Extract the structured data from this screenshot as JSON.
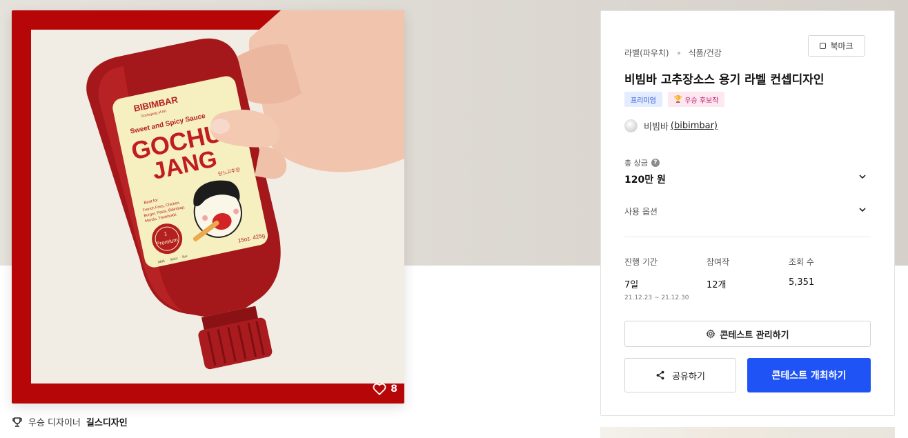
{
  "artwork": {
    "brand_text": "BIBIMBAR",
    "brand_sub": "Gochujang of Art",
    "label_line": "Sweet and Spicy Sauce",
    "product_word_1": "GOCHU",
    "product_word_2": "JANG",
    "korean_small": "단느고추장",
    "best_for": "Best for",
    "uses": [
      "French Fries, Chicken,",
      "Burger, Pasta, Bibimbap,",
      "Mandu, Tteokbokki"
    ],
    "premium_text": "Premium",
    "premium_no": "1",
    "net_weight": "15oz. 425g",
    "spice_scale": [
      "Mild",
      "Spicy",
      "Hot"
    ],
    "like_count": "8"
  },
  "winner": {
    "prefix": "우승 디자이너",
    "name": "길스디자인"
  },
  "panel": {
    "category_main": "라벨(파우치)",
    "category_sub": "식품/건강",
    "bookmark_label": "북마크",
    "title": "비빔바 고추장소스 용기 라벨 컨셉디자인",
    "badges": {
      "premium": "프리미엄",
      "winner": "우승 후보작"
    },
    "owner_name": "비빔바",
    "owner_handle": "(bibimbar)",
    "prize_label": "총 상금",
    "prize_value": "120만 원",
    "usage_label": "사용 옵션",
    "stats": {
      "period_label": "진행 기간",
      "period_value": "7일",
      "period_range": "21.12.23 ~ 21.12.30",
      "entries_label": "참여작",
      "entries_value": "12개",
      "views_label": "조회 수",
      "views_value": "5,351"
    },
    "manage_label": "콘테스트 관리하기",
    "share_label": "공유하기",
    "host_label": "콘테스트 개최하기"
  },
  "colors": {
    "accent": "#2053f5",
    "frame_red": "#b70608",
    "bottle_red": "#9e1a1c"
  }
}
